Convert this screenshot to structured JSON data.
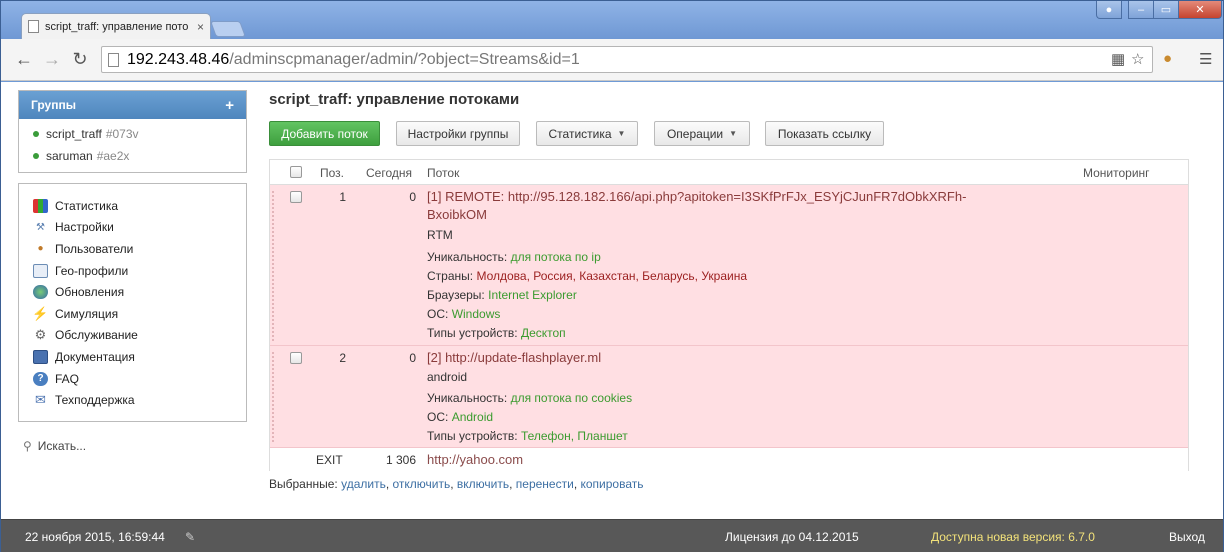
{
  "browser": {
    "tab_title": "script_traff: управление пото",
    "tab_close": "×",
    "url_host": "192.243.48.46",
    "url_path": "/adminscpmanager/admin/?object=Streams&id=1",
    "window_min": "‒",
    "window_max": "▭",
    "window_close": "✕"
  },
  "sidebar": {
    "groups_title": "Группы",
    "groups_add": "+",
    "groups": [
      {
        "name": "script_traff",
        "code": "#073v"
      },
      {
        "name": "saruman",
        "code": "#ae2x"
      }
    ],
    "menu": [
      {
        "label": "Статистика",
        "icon": "chart-icon"
      },
      {
        "label": "Настройки",
        "icon": "wrench-icon"
      },
      {
        "label": "Пользователи",
        "icon": "users-icon"
      },
      {
        "label": "Гео-профили",
        "icon": "geo-table-icon"
      },
      {
        "label": "Обновления",
        "icon": "globe-icon"
      },
      {
        "label": "Симуляция",
        "icon": "lightning-icon"
      },
      {
        "label": "Обслуживание",
        "icon": "shield-gear-icon"
      },
      {
        "label": "Документация",
        "icon": "book-icon"
      },
      {
        "label": "FAQ",
        "icon": "help-icon"
      },
      {
        "label": "Техподдержка",
        "icon": "mail-icon"
      }
    ],
    "search_label": "Искать..."
  },
  "main": {
    "title": "script_traff: управление потоками",
    "buttons": {
      "add": "Добавить поток",
      "group_settings": "Настройки группы",
      "stats": "Статистика",
      "operations": "Операции",
      "show_link": "Показать ссылку"
    },
    "table": {
      "headers": {
        "pos": "Поз.",
        "today": "Сегодня",
        "stream": "Поток",
        "monitoring": "Мониторинг"
      },
      "rows": [
        {
          "pos": "1",
          "today": "0",
          "title_line1": "[1] REMOTE: http://95.128.182.166/api.php?apitoken=I3SKfPrFJx_ESYjCJunFR7dObkXRFh-",
          "title_line2": "BxoibkOM",
          "name": "RTM",
          "uniq_label": "Уникальность:",
          "uniq_value": "для потока по ip",
          "countries_label": "Страны:",
          "countries_value": "Молдова, Россия, Казахстан, Беларусь, Украина",
          "browsers_label": "Браузеры:",
          "browsers_value": "Internet Explorer",
          "os_label": "ОС:",
          "os_value": "Windows",
          "devices_label": "Типы устройств:",
          "devices_value": "Десктоп"
        },
        {
          "pos": "2",
          "today": "0",
          "title_line1": "[2] http://update-flashplayer.ml",
          "name": "android",
          "uniq_label": "Уникальность:",
          "uniq_value": "для потока по cookies",
          "os_label": "ОС:",
          "os_value": "Android",
          "devices_label": "Типы устройств:",
          "devices_value": "Телефон, Планшет"
        }
      ],
      "exit_row": {
        "pos": "EXIT",
        "today": "1 306",
        "url": "http://yahoo.com"
      }
    },
    "selected": {
      "label": "Выбранные:",
      "actions": [
        "удалить",
        "отключить",
        "включить",
        "перенести",
        "копировать"
      ]
    }
  },
  "statusbar": {
    "datetime": "22 ноября 2015, 16:59:44",
    "license": "Лицензия до 04.12.2015",
    "new_version": "Доступна новая версия: 6.7.0",
    "logout": "Выход",
    "new_version_color": "#f3e27a"
  }
}
